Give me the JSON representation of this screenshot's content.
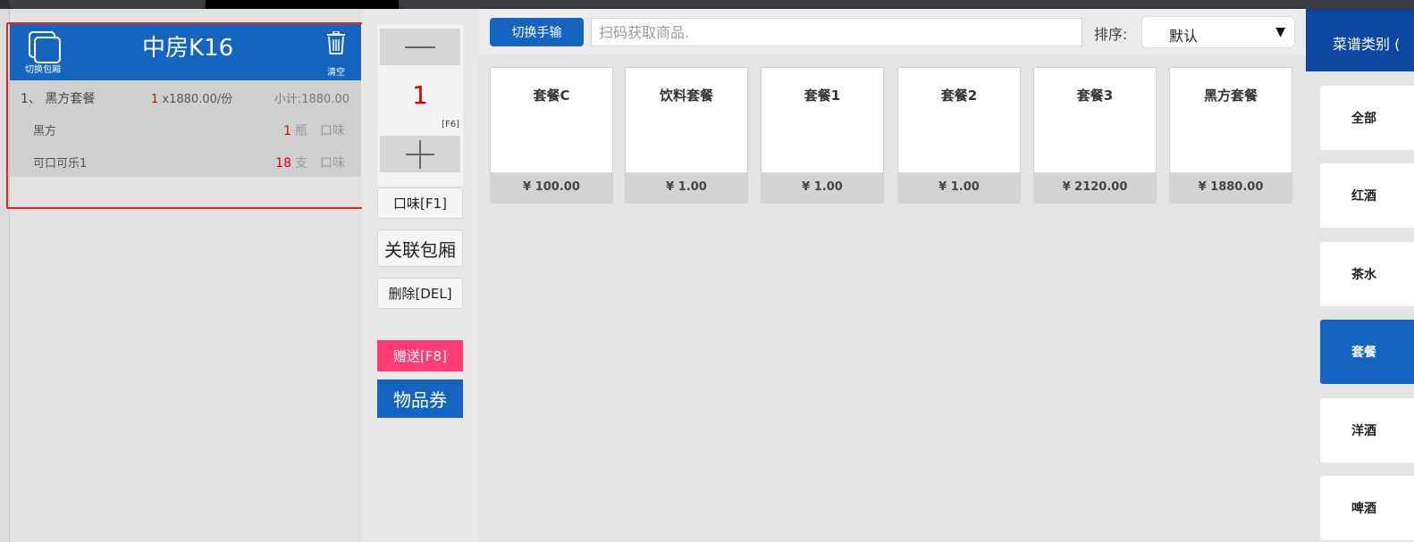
{
  "order": {
    "switch_room_label": "切换包厢",
    "room_name": "中房K16",
    "clear_label": "清空",
    "items": [
      {
        "index": "1、",
        "name": "黑方套餐",
        "qty": "1",
        "price": "x1880.00/份",
        "subtotal": "小计:1880.00"
      }
    ],
    "sub_items": [
      {
        "name": "黑方",
        "qty": "1",
        "unit": "瓶",
        "flavor": "口味"
      },
      {
        "name": "可口可乐1",
        "qty": "18",
        "unit": "支",
        "flavor": "口味"
      }
    ]
  },
  "controls": {
    "minus": "—",
    "quantity": "1",
    "plus": "+",
    "qty_key": "[F6]",
    "flavor_button": "口味[F1]",
    "link_room_button": "关联包厢",
    "delete_button": "删除[DEL]",
    "gift_button": "赠送[F8]",
    "voucher_button": "物品券"
  },
  "toolbar": {
    "switch_manual": "切换手输",
    "scan_placeholder": "扫码获取商品.",
    "sort_label": "排序:",
    "sort_value": "默认"
  },
  "products": [
    {
      "name": "套餐C",
      "price": "¥ 100.00"
    },
    {
      "name": "饮料套餐",
      "price": "¥ 1.00"
    },
    {
      "name": "套餐1",
      "price": "¥ 1.00"
    },
    {
      "name": "套餐2",
      "price": "¥ 1.00"
    },
    {
      "name": "套餐3",
      "price": "¥ 2120.00"
    },
    {
      "name": "黑方套餐",
      "price": "¥ 1880.00"
    }
  ],
  "categories": {
    "header": "菜谱类别 (",
    "items": [
      {
        "label": "全部",
        "active": false
      },
      {
        "label": "红酒",
        "active": false
      },
      {
        "label": "茶水",
        "active": false
      },
      {
        "label": "套餐",
        "active": true
      },
      {
        "label": "洋酒",
        "active": false
      },
      {
        "label": "啤酒",
        "active": false
      }
    ]
  },
  "colors": {
    "primary": "#1565c0",
    "gift": "#ff3c75",
    "highlight": "#f02020",
    "qty_red": "#e00000"
  }
}
